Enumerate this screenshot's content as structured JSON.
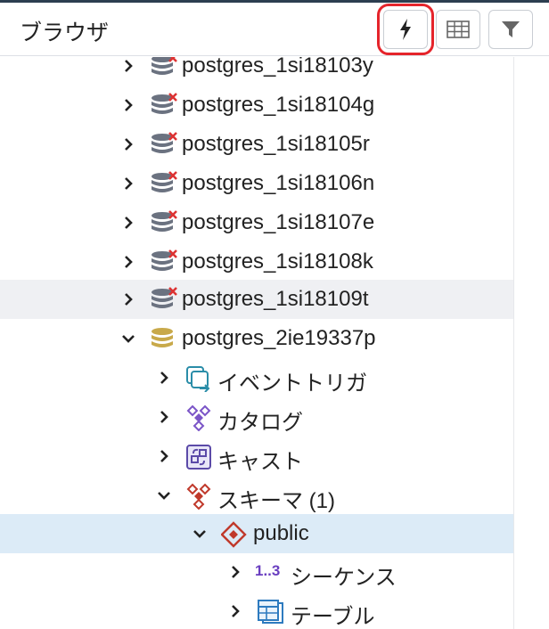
{
  "header": {
    "title": "ブラウザ",
    "buttons": [
      {
        "name": "query-tool",
        "icon": "lightning-icon"
      },
      {
        "name": "view-data",
        "icon": "table-icon"
      },
      {
        "name": "filter",
        "icon": "filter-icon"
      }
    ]
  },
  "tree": {
    "items": [
      {
        "label": "postgres_1si18103y",
        "icon": "server-disconnected-icon",
        "expanded": false
      },
      {
        "label": "postgres_1si18104g",
        "icon": "server-disconnected-icon",
        "expanded": false
      },
      {
        "label": "postgres_1si18105r",
        "icon": "server-disconnected-icon",
        "expanded": false
      },
      {
        "label": "postgres_1si18106n",
        "icon": "server-disconnected-icon",
        "expanded": false
      },
      {
        "label": "postgres_1si18107e",
        "icon": "server-disconnected-icon",
        "expanded": false
      },
      {
        "label": "postgres_1si18108k",
        "icon": "server-disconnected-icon",
        "expanded": false
      },
      {
        "label": "postgres_1si18109t",
        "icon": "server-disconnected-icon",
        "expanded": false
      },
      {
        "label": "postgres_2ie19337p",
        "icon": "database-icon",
        "expanded": true
      },
      {
        "label": "イベントトリガ",
        "icon": "event-trigger-icon",
        "expanded": false
      },
      {
        "label": "カタログ",
        "icon": "catalog-icon",
        "expanded": false
      },
      {
        "label": "キャスト",
        "icon": "cast-icon",
        "expanded": false
      },
      {
        "label": "スキーマ (1)",
        "icon": "schemas-icon",
        "expanded": true
      },
      {
        "label": "public",
        "icon": "schema-icon",
        "expanded": true
      },
      {
        "label": "シーケンス",
        "icon": "sequence-icon",
        "expanded": false
      },
      {
        "label": "テーブル",
        "icon": "table-icon",
        "expanded": false
      }
    ]
  },
  "colors": {
    "highlight": "#e5242b",
    "selected_row": "#dcebf7",
    "hover_row": "#eff0f3",
    "server_icon": "#6b7280",
    "database_icon": "#c8a94a",
    "catalog_icon": "#7b55c7",
    "schema_icon": "#c0392b"
  }
}
